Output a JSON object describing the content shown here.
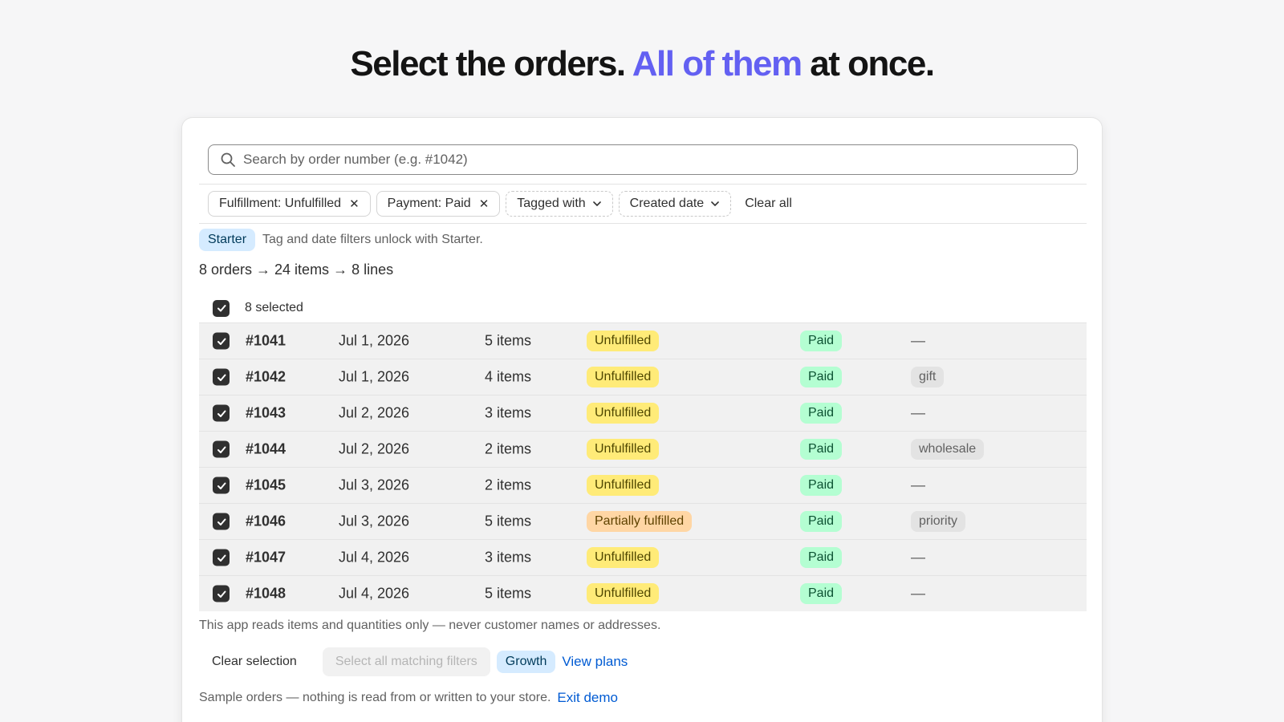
{
  "headline": {
    "part1": "Select the orders. ",
    "accent": "All of them",
    "part2": " at once."
  },
  "search": {
    "placeholder": "Search by order number (e.g. #1042)",
    "value": ""
  },
  "filters": {
    "fulfillment": "Fulfillment: Unfulfilled",
    "payment": "Payment: Paid",
    "tagged": "Tagged with",
    "created": "Created date",
    "clear_all": "Clear all"
  },
  "notice": {
    "badge": "Starter",
    "text": "Tag and date filters unlock with Starter."
  },
  "summary": "8 orders → 24 items → 8 lines",
  "selection": {
    "label": "8 selected"
  },
  "orders": [
    {
      "number": "#1041",
      "date": "Jul 1, 2026",
      "items": "5 items",
      "fulfillment": "Unfulfilled",
      "payment": "Paid",
      "tag": "—"
    },
    {
      "number": "#1042",
      "date": "Jul 1, 2026",
      "items": "4 items",
      "fulfillment": "Unfulfilled",
      "payment": "Paid",
      "tag": "gift"
    },
    {
      "number": "#1043",
      "date": "Jul 2, 2026",
      "items": "3 items",
      "fulfillment": "Unfulfilled",
      "payment": "Paid",
      "tag": "—"
    },
    {
      "number": "#1044",
      "date": "Jul 2, 2026",
      "items": "2 items",
      "fulfillment": "Unfulfilled",
      "payment": "Paid",
      "tag": "wholesale"
    },
    {
      "number": "#1045",
      "date": "Jul 3, 2026",
      "items": "2 items",
      "fulfillment": "Unfulfilled",
      "payment": "Paid",
      "tag": "—"
    },
    {
      "number": "#1046",
      "date": "Jul 3, 2026",
      "items": "5 items",
      "fulfillment": "Partially fulfilled",
      "payment": "Paid",
      "tag": "priority"
    },
    {
      "number": "#1047",
      "date": "Jul 4, 2026",
      "items": "3 items",
      "fulfillment": "Unfulfilled",
      "payment": "Paid",
      "tag": "—"
    },
    {
      "number": "#1048",
      "date": "Jul 4, 2026",
      "items": "5 items",
      "fulfillment": "Unfulfilled",
      "payment": "Paid",
      "tag": "—"
    }
  ],
  "privacy_note": "This app reads items and quantities only — never customer names or addresses.",
  "actions": {
    "clear_selection": "Clear selection",
    "select_all_matching": "Select all matching filters",
    "growth_badge": "Growth",
    "view_plans": "View plans"
  },
  "footer": {
    "text": "Sample orders — nothing is read from or written to your store.",
    "exit_demo": "Exit demo"
  },
  "colors": {
    "accent": "#6360f2",
    "link": "#005bd3",
    "unfulfilled": "#ffeb78",
    "partially_fulfilled": "#ffd6a4",
    "paid": "#b4fed2",
    "plan_badge": "#d5ebff"
  },
  "icons": {
    "search": "search-icon",
    "remove_filter": "close-icon",
    "dropdown": "chevron-down-icon",
    "checked": "checkmark-icon"
  }
}
